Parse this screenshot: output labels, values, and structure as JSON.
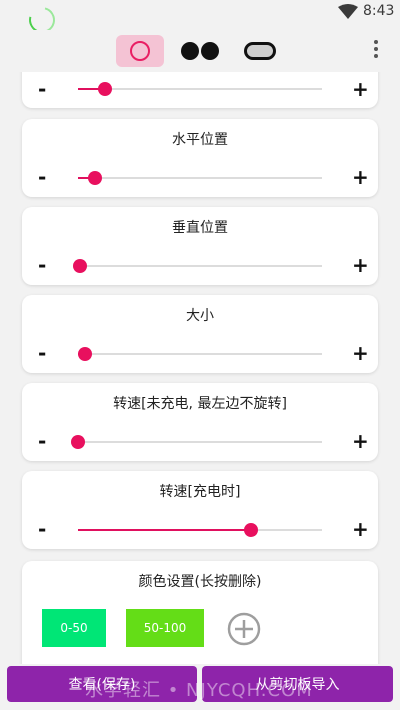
{
  "status_bar": {
    "time": "8:43"
  },
  "toolbar": {
    "tools": [
      {
        "name": "circle",
        "selected": true
      },
      {
        "name": "dots",
        "selected": false
      },
      {
        "name": "pill",
        "selected": false
      }
    ]
  },
  "sliders": [
    {
      "title": "",
      "minus": "-",
      "plus": "+",
      "value": 0.11
    },
    {
      "title": "水平位置",
      "minus": "-",
      "plus": "+",
      "value": 0.07
    },
    {
      "title": "垂直位置",
      "minus": "-",
      "plus": "+",
      "value": 0.01
    },
    {
      "title": "大小",
      "minus": "-",
      "plus": "+",
      "value": 0.03
    },
    {
      "title": "转速[未充电, 最左边不旋转]",
      "minus": "-",
      "plus": "+",
      "value": 0.0
    },
    {
      "title": "转速[充电时]",
      "minus": "-",
      "plus": "+",
      "value": 0.71
    }
  ],
  "color_settings": {
    "title": "颜色设置(长按删除)",
    "swatches": [
      {
        "label": "0-50",
        "color": "#00e676"
      },
      {
        "label": "50-100",
        "color": "#64dd17"
      }
    ]
  },
  "buttons": {
    "view_save": "查看(保存)",
    "import_clipboard": "从剪切板导入"
  },
  "watermark": "水学轻汇 • NJYCQH.COM",
  "colors": {
    "accent": "#e8105e",
    "button": "#8e24aa",
    "selected_bg": "#f4c3d4"
  }
}
